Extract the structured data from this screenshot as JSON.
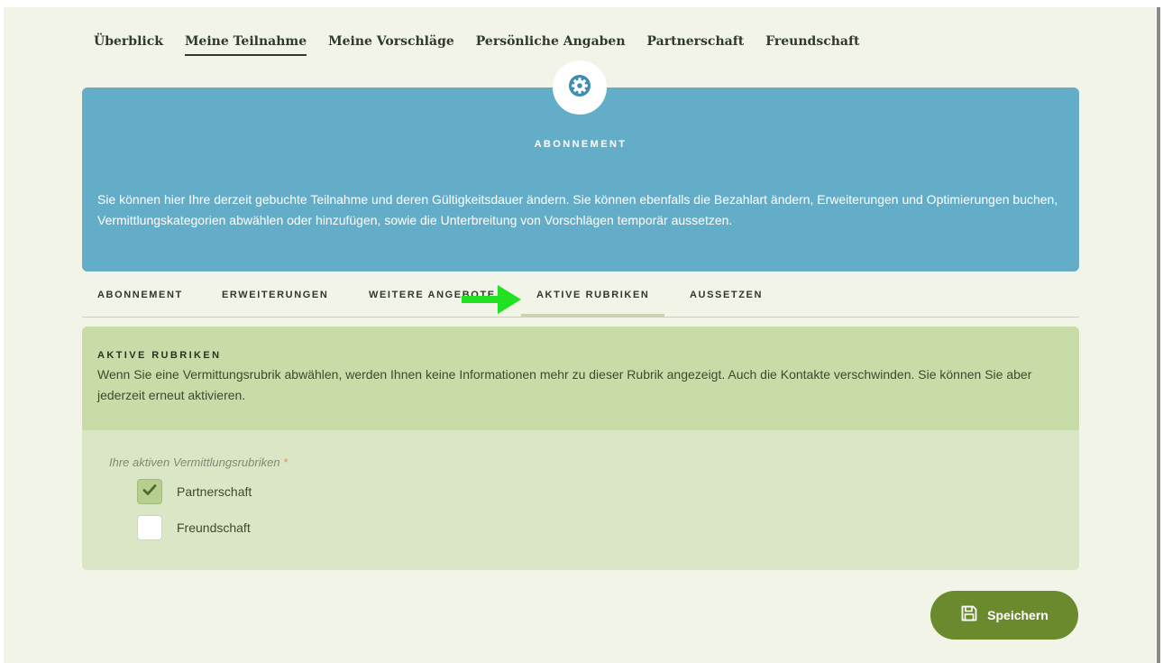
{
  "topnav": {
    "items": [
      {
        "label": "Überblick"
      },
      {
        "label": "Meine Teilnahme"
      },
      {
        "label": "Meine Vorschläge"
      },
      {
        "label": "Persönliche Angaben"
      },
      {
        "label": "Partnerschaft"
      },
      {
        "label": "Freundschaft"
      }
    ],
    "active_index": 1
  },
  "banner": {
    "icon": "gear-icon",
    "title": "ABONNEMENT",
    "text": "Sie können hier Ihre derzeit gebuchte Teilnahme und deren Gültigkeitsdauer ändern. Sie können ebenfalls die Bezahlart ändern, Erweiterungen und Optimierungen buchen, Vermittlungskategorien abwählen oder hinzufügen, sowie die Unterbreitung von Vorschlägen temporär aussetzen.",
    "color": "#64adc9"
  },
  "tabs": {
    "items": [
      {
        "label": "ABONNEMENT"
      },
      {
        "label": "ERWEITERUNGEN"
      },
      {
        "label": "WEITERE ANGEBOTE"
      },
      {
        "label": "AKTIVE RUBRIKEN"
      },
      {
        "label": "AUSSETZEN"
      }
    ],
    "active_index": 3
  },
  "annotation": {
    "icon": "arrow-right-icon",
    "color": "#22e022"
  },
  "panel": {
    "title": "AKTIVE RUBRIKEN",
    "text": "Wenn Sie eine Vermittungsrubrik abwählen, werden Ihnen keine Informationen mehr zu dieser Rubrik angezeigt. Auch die Kontakte verschwinden. Sie können Sie aber jederzeit erneut aktivieren.",
    "field_label": "Ihre aktiven Vermittlungsrubriken",
    "required_mark": "*",
    "options": [
      {
        "label": "Partnerschaft",
        "checked": true
      },
      {
        "label": "Freundschaft",
        "checked": false
      }
    ]
  },
  "save": {
    "label": "Speichern",
    "icon": "floppy-disk-icon",
    "color": "#6b8a2e"
  }
}
